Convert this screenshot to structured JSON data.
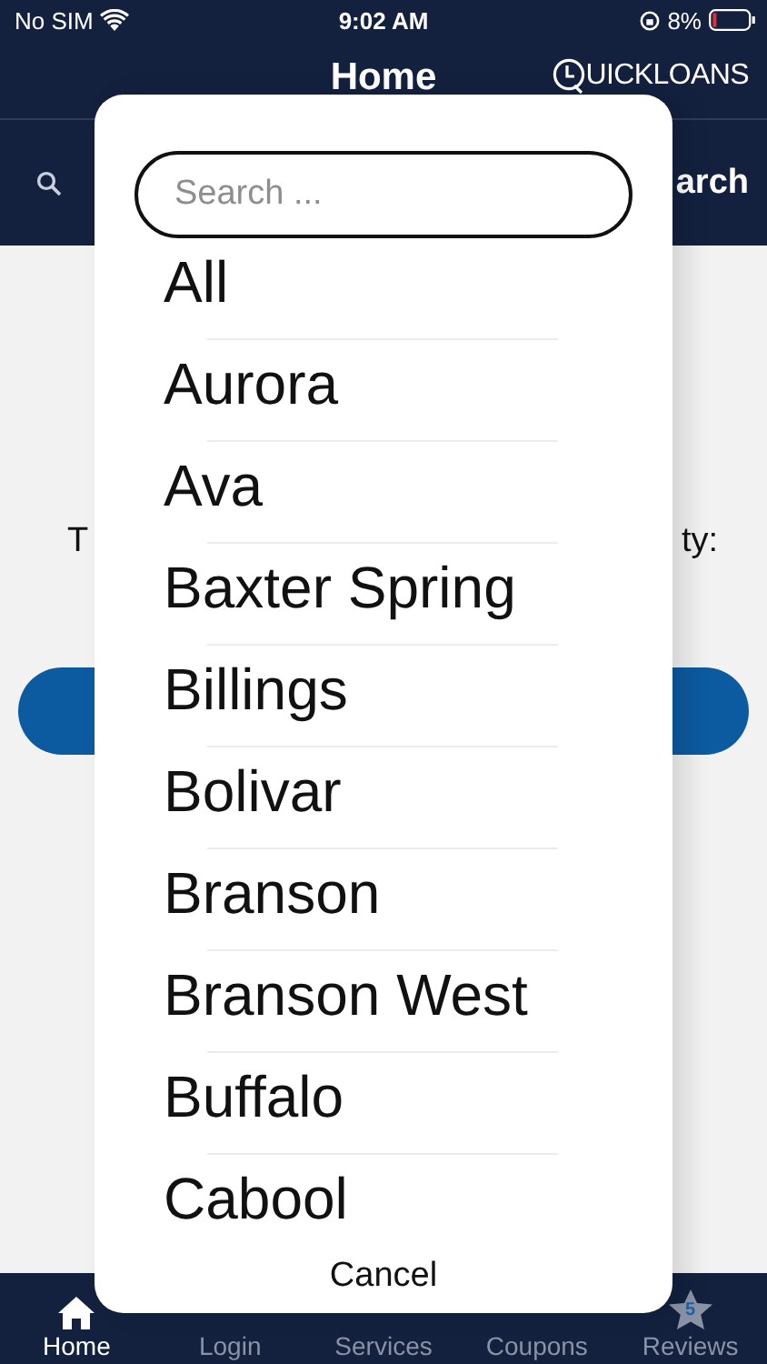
{
  "status_bar": {
    "carrier": "No SIM",
    "time": "9:02 AM",
    "battery": "8%"
  },
  "header": {
    "title": "Home",
    "logo_bold": "UICK",
    "logo_light": "LOANS"
  },
  "search_row": {
    "right_fragment": "arch"
  },
  "content": {
    "left_fragment": "T",
    "right_fragment": "ty:"
  },
  "picker": {
    "search": {
      "placeholder": "Search ..."
    },
    "items": [
      "All",
      "Aurora",
      "Ava",
      "Baxter Spring",
      "Billings",
      "Bolivar",
      "Branson",
      "Branson West",
      "Buffalo",
      "Cabool"
    ],
    "cancel": "Cancel"
  },
  "tab_bar": [
    {
      "label": "Home",
      "selected": true,
      "kind": "home"
    },
    {
      "label": "Login",
      "selected": false,
      "kind": "covered"
    },
    {
      "label": "Services",
      "selected": false,
      "kind": "covered"
    },
    {
      "label": "Coupons",
      "selected": false,
      "kind": "covered"
    },
    {
      "label": "Reviews",
      "selected": false,
      "kind": "star",
      "badge": "5"
    }
  ]
}
